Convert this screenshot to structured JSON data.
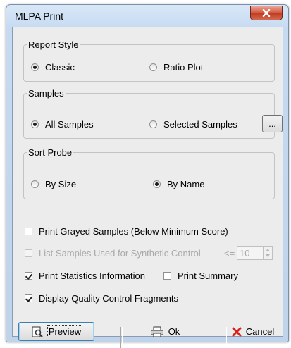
{
  "window": {
    "title": "MLPA Print"
  },
  "report_style": {
    "legend": "Report Style",
    "options": [
      {
        "label": "Classic",
        "selected": true
      },
      {
        "label": "Ratio Plot",
        "selected": false
      }
    ]
  },
  "samples": {
    "legend": "Samples",
    "options": [
      {
        "label": "All Samples",
        "selected": true
      },
      {
        "label": "Selected Samples",
        "selected": false
      }
    ],
    "browse_label": "..."
  },
  "sort_probe": {
    "legend": "Sort Probe",
    "options": [
      {
        "label": "By Size",
        "selected": false
      },
      {
        "label": "By Name",
        "selected": true
      }
    ]
  },
  "options": {
    "print_grayed": {
      "label": "Print Grayed Samples (Below Minimum Score)",
      "checked": false
    },
    "list_synthetic": {
      "label": "List Samples Used for Synthetic Control",
      "checked": false,
      "enabled": false
    },
    "threshold_operator": "<=",
    "threshold_value": "10",
    "print_statistics": {
      "label": "Print Statistics Information",
      "checked": true
    },
    "print_summary": {
      "label": "Print Summary",
      "checked": false
    },
    "display_qc": {
      "label": "Display Quality Control Fragments",
      "checked": true
    }
  },
  "buttons": {
    "preview": "Preview",
    "ok": "Ok",
    "cancel": "Cancel"
  },
  "colors": {
    "cancel_x": "#d8231c",
    "close_button": "#c8452b"
  }
}
